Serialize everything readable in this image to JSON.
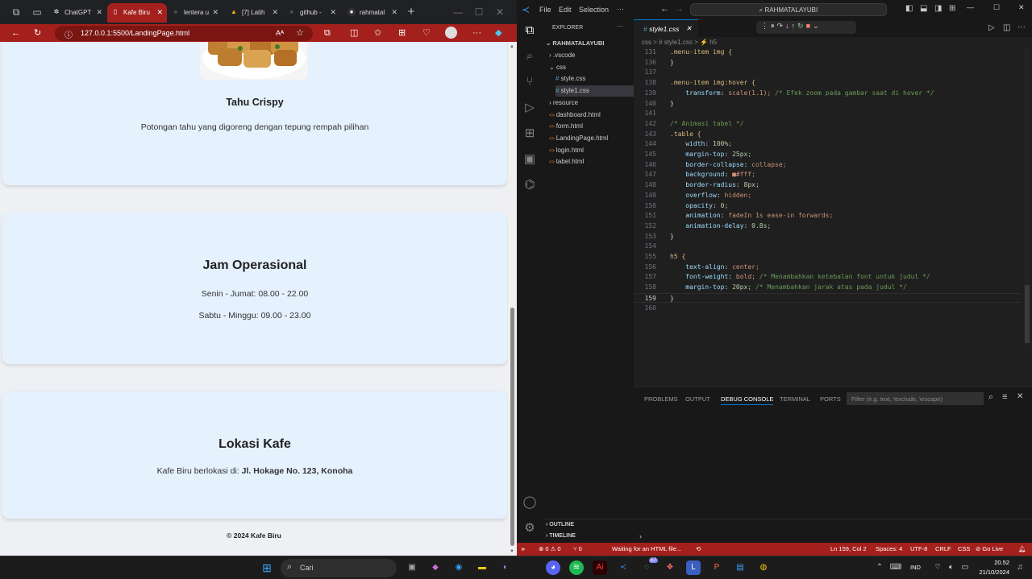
{
  "browser": {
    "tabs": [
      {
        "label": "ChatGPT",
        "icon": "chatgpt-icon",
        "active": false
      },
      {
        "label": "Kafe Biru",
        "icon": "page-icon",
        "active": true
      },
      {
        "label": "lentera u",
        "icon": "search-icon",
        "active": false
      },
      {
        "label": "[7] Latih",
        "icon": "drive-icon",
        "active": false
      },
      {
        "label": "github -",
        "icon": "search-icon",
        "active": false
      },
      {
        "label": "rahmatal",
        "icon": "github-icon",
        "active": false
      }
    ],
    "url": "127.0.0.1:5500/LandingPage.html",
    "page": {
      "menu_item": {
        "title": "Tahu Crispy",
        "desc": "Potongan tahu yang digoreng dengan tepung rempah pilihan"
      },
      "hours": {
        "title": "Jam Operasional",
        "line1": "Senin - Jumat: 08.00 - 22.00",
        "line2": "Sabtu - Minggu: 09.00 - 23.00"
      },
      "location": {
        "title": "Lokasi Kafe",
        "prefix": "Kafe Biru berlokasi di:",
        "address": "Jl. Hokage No. 123, Konoha"
      },
      "footer": "© 2024 Kafe Biru"
    }
  },
  "vscode": {
    "menu": [
      "File",
      "Edit",
      "Selection",
      "···"
    ],
    "search": "RAHMATALAYUBI",
    "explorer_title": "EXPLORER",
    "root": "RAHMATALAYUBI",
    "tree": [
      {
        "label": ".vscode",
        "kind": "folder",
        "indent": 1
      },
      {
        "label": "css",
        "kind": "folder-open",
        "indent": 1
      },
      {
        "label": "style.css",
        "kind": "css",
        "indent": 2
      },
      {
        "label": "style1.css",
        "kind": "css",
        "indent": 2,
        "selected": true
      },
      {
        "label": "resource",
        "kind": "folder",
        "indent": 1
      },
      {
        "label": "dashboard.html",
        "kind": "html",
        "indent": 1
      },
      {
        "label": "form.html",
        "kind": "html",
        "indent": 1
      },
      {
        "label": "LandingPage.html",
        "kind": "html",
        "indent": 1
      },
      {
        "label": "login.html",
        "kind": "html",
        "indent": 1
      },
      {
        "label": "tabel.html",
        "kind": "html",
        "indent": 1
      }
    ],
    "editor_tab": "style1.css",
    "breadcrumbs": "css  >  # style1.css  >  ⚡ h5",
    "code": [
      {
        "n": "131",
        "t": "sel",
        "c": ".menu-item img {"
      },
      {
        "n": "136",
        "t": "pl",
        "c": "}"
      },
      {
        "n": "137",
        "t": "pl",
        "c": ""
      },
      {
        "n": "138",
        "t": "sel",
        "c": ".menu-item img:hover {"
      },
      {
        "n": "139",
        "t": "mix",
        "p": "    transform",
        "v": " scale(1.1);",
        "k": " /* Efek zoom pada gambar saat di hover */"
      },
      {
        "n": "140",
        "t": "pl",
        "c": "}"
      },
      {
        "n": "141",
        "t": "pl",
        "c": ""
      },
      {
        "n": "142",
        "t": "cmt",
        "c": "/* Animasi tabel */"
      },
      {
        "n": "143",
        "t": "sel",
        "c": ".table {"
      },
      {
        "n": "144",
        "t": "mix",
        "p": "    width",
        "v": " 100%;",
        "k": ""
      },
      {
        "n": "145",
        "t": "mix",
        "p": "    margin-top",
        "v": " 25px;",
        "k": ""
      },
      {
        "n": "146",
        "t": "mix",
        "p": "    border-collapse",
        "v": " collapse;",
        "k": ""
      },
      {
        "n": "147",
        "t": "mix",
        "p": "    background",
        "v": " ■#fff;",
        "k": ""
      },
      {
        "n": "148",
        "t": "mix",
        "p": "    border-radius",
        "v": " 8px;",
        "k": ""
      },
      {
        "n": "149",
        "t": "mix",
        "p": "    overflow",
        "v": " hidden;",
        "k": ""
      },
      {
        "n": "150",
        "t": "mix",
        "p": "    opacity",
        "v": " 0;",
        "k": ""
      },
      {
        "n": "151",
        "t": "mix",
        "p": "    animation",
        "v": " fadeIn 1s ease-in forwards;",
        "k": ""
      },
      {
        "n": "152",
        "t": "mix",
        "p": "    animation-delay",
        "v": " 0.8s;",
        "k": ""
      },
      {
        "n": "153",
        "t": "pl",
        "c": "}"
      },
      {
        "n": "154",
        "t": "pl",
        "c": ""
      },
      {
        "n": "155",
        "t": "sel",
        "c": "h5 {"
      },
      {
        "n": "156",
        "t": "mix",
        "p": "    text-align",
        "v": " center;",
        "k": ""
      },
      {
        "n": "157",
        "t": "mix",
        "p": "    font-weight",
        "v": " bold;",
        "k": " /* Menambahkan ketebalan font untuk judul */"
      },
      {
        "n": "158",
        "t": "mix",
        "p": "    margin-top",
        "v": " 20px;",
        "k": " /* Menambahkan jarak atas pada judul */"
      },
      {
        "n": "159",
        "t": "pl",
        "c": "}"
      },
      {
        "n": "160",
        "t": "pl",
        "c": ""
      }
    ],
    "panel_tabs": [
      "PROBLEMS",
      "OUTPUT",
      "DEBUG CONSOLE",
      "TERMINAL",
      "PORTS"
    ],
    "panel_active": "DEBUG CONSOLE",
    "filter_placeholder": "Filter (e.g. text, !exclude, \\escape)",
    "outline": "OUTLINE",
    "timeline": "TIMELINE",
    "status": {
      "errors": "⊗ 0 ⚠ 0",
      "ports": "⑂ 0",
      "message": "Waiting for an HTML file...",
      "position": "Ln 159, Col 2",
      "spaces": "Spaces: 4",
      "encoding": "UTF-8",
      "eol": "CRLF",
      "lang": "CSS",
      "golive": "⊘ Go Live"
    }
  },
  "taskbar": {
    "search": "Cari",
    "lang": "IND",
    "time": "20.52",
    "date": "21/10/2024",
    "whatsapp_badge": "57"
  },
  "colors": {
    "accent": "#a4201c",
    "card": "#e5f1fd"
  }
}
